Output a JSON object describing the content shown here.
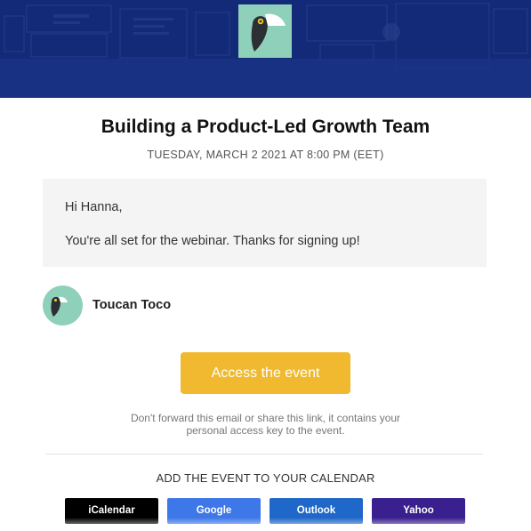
{
  "header": {
    "logo_icon": "toucan-logo-icon",
    "banner_color": "#132a78",
    "logo_bg_color": "#8fd0bb"
  },
  "event": {
    "title": "Building a Product-Led Growth Team",
    "datetime": "TUESDAY, MARCH 2 2021 AT 8:00 PM (EET)"
  },
  "message": {
    "greeting": "Hi Hanna,",
    "body": "You're all set for the webinar. Thanks for signing up!"
  },
  "organizer": {
    "name": "Toucan Toco",
    "avatar_text": "TOUCAN TOCO"
  },
  "cta": {
    "label": "Access the event",
    "color": "#f0b92f"
  },
  "disclaimer": {
    "line1": "Don't forward this email or share this link, it contains your",
    "line2": "personal access key to the event."
  },
  "calendar": {
    "heading": "ADD THE EVENT TO YOUR CALENDAR",
    "buttons": [
      {
        "label": "iCalendar",
        "color": "#000000"
      },
      {
        "label": "Google",
        "color": "#3d77e8"
      },
      {
        "label": "Outlook",
        "color": "#1f67c9"
      },
      {
        "label": "Yahoo",
        "color": "#3a1f8e"
      }
    ]
  }
}
